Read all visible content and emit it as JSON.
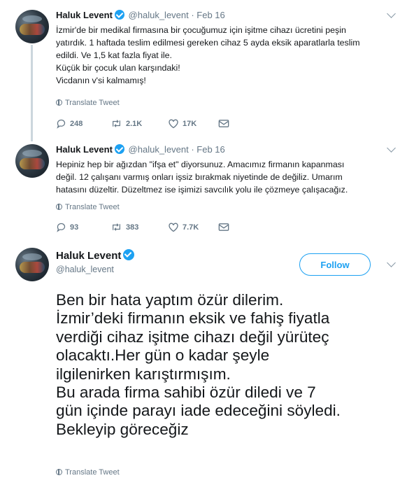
{
  "tweets": [
    {
      "name": "Haluk Levent",
      "meta": "@haluk_levent · Feb 16",
      "lines": [
        "İzmir'de bir medikal firmasına bir çocuğumuz için işitme cihazı ücretini peşin",
        "yatırdık. 1 haftada teslim edilmesi gereken cihaz 5 ayda eksik aparatlarla teslim",
        "edildi. Ve 1,5 kat fazla fiyat ile.",
        "Küçük bir çocuk ulan karşındaki!",
        "Vicdanın v'si kalmamış!"
      ],
      "translate": "Translate Tweet",
      "replies": "248",
      "retweets": "2.1K",
      "likes": "17K"
    },
    {
      "name": "Haluk Levent",
      "meta": "@haluk_levent · Feb 16",
      "lines": [
        "Hepiniz hep bir ağızdan \"ifşa et\" diyorsunuz. Amacımız firmanın kapanması",
        "değil. 12 çalışanı varmış onları işsiz bırakmak niyetinde de değiliz. Umarım",
        "hatasını düzeltir. Düzeltmez ise işimizi savcılık yolu ile çözmeye çalışacağız."
      ],
      "translate": "Translate Tweet",
      "replies": "93",
      "retweets": "383",
      "likes": "7.7K"
    }
  ],
  "main_tweet": {
    "name": "Haluk Levent",
    "handle": "@haluk_levent",
    "follow_label": "Follow",
    "lines": [
      "Ben bir hata yaptım özür dilerim.",
      "İzmir’deki firmanın eksik ve fahiş fiyatla",
      "verdiği cihaz işitme cihazı değil yürüteç",
      "olacaktı.Her gün o kadar şeyle",
      "ilgilenirken karıştırmışım.",
      "Bu arada firma sahibi özür diledi ve 7",
      "gün içinde parayı iade edeceğini söyledi.",
      "Bekleyip göreceğiz"
    ],
    "translate": "Translate Tweet"
  },
  "colors": {
    "accent": "#1da1f2",
    "text": "#14171a",
    "muted": "#657786",
    "thread_line": "#ccd6dd"
  },
  "icons": [
    "verified-badge-icon",
    "chevron-down-icon",
    "globe-icon",
    "reply-icon",
    "retweet-icon",
    "like-icon",
    "dm-icon"
  ]
}
